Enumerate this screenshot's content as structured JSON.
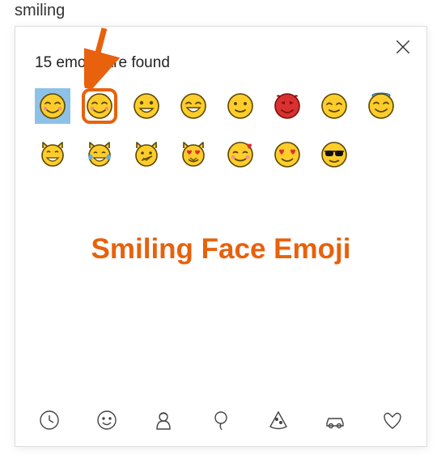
{
  "search": {
    "query": "smiling"
  },
  "header": {
    "results_text": "15 emojis are found"
  },
  "emojis": [
    {
      "name": "smiling-face-blush",
      "kind": "smileBlush",
      "selected": true,
      "highlighted": false
    },
    {
      "name": "smiling-face-smiling-eyes",
      "kind": "smileBlush",
      "selected": false,
      "highlighted": true
    },
    {
      "name": "grinning-face",
      "kind": "grin",
      "selected": false,
      "highlighted": false
    },
    {
      "name": "beaming-face",
      "kind": "beaming",
      "selected": false,
      "highlighted": false
    },
    {
      "name": "slightly-smiling-face",
      "kind": "slight",
      "selected": false,
      "highlighted": false
    },
    {
      "name": "smiling-devil",
      "kind": "devil",
      "selected": false,
      "highlighted": false
    },
    {
      "name": "smiling-face-relaxed",
      "kind": "relaxed",
      "selected": false,
      "highlighted": false
    },
    {
      "name": "smiling-face-halo",
      "kind": "halo",
      "selected": false,
      "highlighted": false
    },
    {
      "name": "grinning-cat",
      "kind": "catGrin",
      "selected": false,
      "highlighted": false
    },
    {
      "name": "cat-tears-of-joy",
      "kind": "catJoy",
      "selected": false,
      "highlighted": false
    },
    {
      "name": "cat-wry-smile",
      "kind": "catWry",
      "selected": false,
      "highlighted": false
    },
    {
      "name": "cat-heart-eyes",
      "kind": "catHeart",
      "selected": false,
      "highlighted": false
    },
    {
      "name": "smiling-face-hearts",
      "kind": "hearts",
      "selected": false,
      "highlighted": false
    },
    {
      "name": "smiling-heart-eyes",
      "kind": "heartEyes",
      "selected": false,
      "highlighted": false
    },
    {
      "name": "smiling-sunglasses",
      "kind": "sunglasses",
      "selected": false,
      "highlighted": false
    }
  ],
  "annotation": {
    "label": "Smiling Face Emoji",
    "arrow_color": "#e8610d"
  },
  "categories": [
    {
      "name": "recent",
      "icon": "clock"
    },
    {
      "name": "smileys",
      "icon": "smiley"
    },
    {
      "name": "people",
      "icon": "person"
    },
    {
      "name": "celebration",
      "icon": "balloon"
    },
    {
      "name": "food",
      "icon": "pizza"
    },
    {
      "name": "transport",
      "icon": "car"
    },
    {
      "name": "symbols",
      "icon": "heart"
    }
  ]
}
